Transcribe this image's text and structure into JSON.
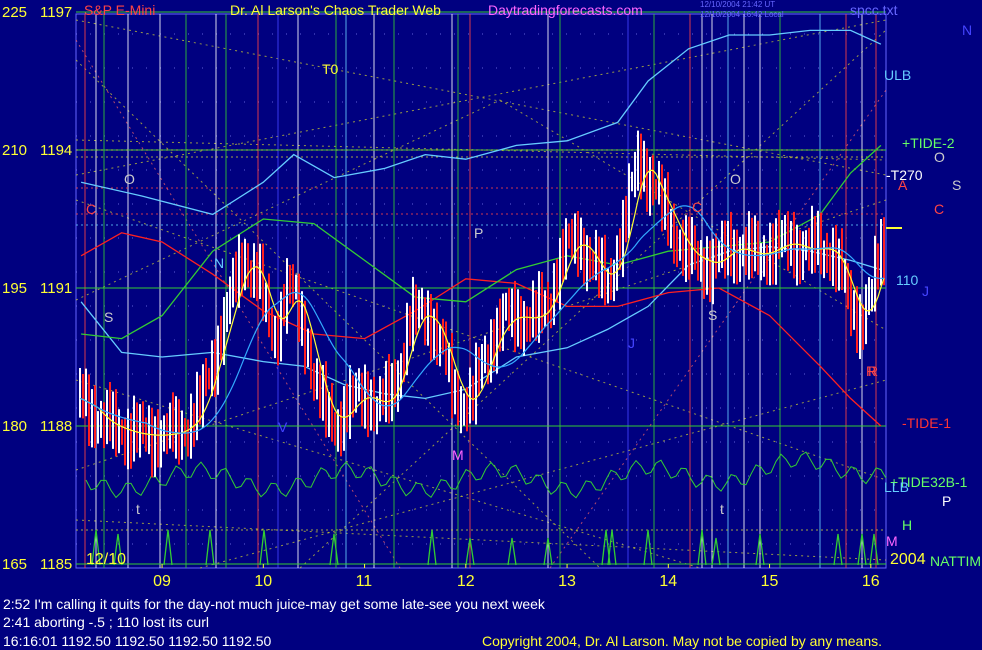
{
  "header": {
    "title_left": "S&P E-Mini",
    "title_center": "Dr. Al Larson's Chaos Trader Web",
    "site": "Daytradingforecasts.com",
    "ts1": "12/10/2004 21:42 UT",
    "ts2": "12/10/2004 16:42 Local",
    "file": "spcc.txt",
    "year": "2004",
    "date": "12/10"
  },
  "chart_data": {
    "type": "line",
    "title": "S&P E-Mini",
    "y_labels": [
      {
        "left": "225",
        "right": "1197",
        "value": 1197
      },
      {
        "left": "210",
        "right": "1194",
        "value": 1194
      },
      {
        "left": "195",
        "right": "1191",
        "value": 1191
      },
      {
        "left": "180",
        "right": "1188",
        "value": 1188
      },
      {
        "left": "165",
        "right": "1185",
        "value": 1185
      }
    ],
    "ylim": [
      1185,
      1197
    ],
    "x_ticks": [
      {
        "label": "09",
        "t": 9
      },
      {
        "label": "10",
        "t": 10
      },
      {
        "label": "11",
        "t": 11
      },
      {
        "label": "12",
        "t": 12
      },
      {
        "label": "13",
        "t": 13
      },
      {
        "label": "14",
        "t": 14
      },
      {
        "label": "15",
        "t": 15
      },
      {
        "label": "16",
        "t": 16
      }
    ],
    "xlim": [
      8.15,
      16.15
    ],
    "price": [
      [
        8.2,
        1188.6
      ],
      [
        8.4,
        1188.1
      ],
      [
        8.6,
        1187.9
      ],
      [
        8.8,
        1187.8
      ],
      [
        9.0,
        1187.8
      ],
      [
        9.2,
        1187.9
      ],
      [
        9.35,
        1188.3
      ],
      [
        9.5,
        1189.4
      ],
      [
        9.65,
        1190.6
      ],
      [
        9.8,
        1191.7
      ],
      [
        9.95,
        1191.2
      ],
      [
        10.1,
        1189.9
      ],
      [
        10.25,
        1191.1
      ],
      [
        10.4,
        1190.1
      ],
      [
        10.55,
        1188.6
      ],
      [
        10.7,
        1188.0
      ],
      [
        10.85,
        1188.5
      ],
      [
        11.0,
        1188.7
      ],
      [
        11.15,
        1188.4
      ],
      [
        11.3,
        1188.9
      ],
      [
        11.45,
        1190.3
      ],
      [
        11.6,
        1190.5
      ],
      [
        11.75,
        1189.8
      ],
      [
        11.9,
        1188.6
      ],
      [
        12.05,
        1188.5
      ],
      [
        12.2,
        1189.6
      ],
      [
        12.35,
        1190.3
      ],
      [
        12.5,
        1190.4
      ],
      [
        12.65,
        1190.3
      ],
      [
        12.8,
        1190.6
      ],
      [
        12.95,
        1191.7
      ],
      [
        13.1,
        1192.1
      ],
      [
        13.25,
        1191.5
      ],
      [
        13.4,
        1191.1
      ],
      [
        13.55,
        1192.2
      ],
      [
        13.7,
        1193.9
      ],
      [
        13.85,
        1193.2
      ],
      [
        14.0,
        1192.5
      ],
      [
        14.15,
        1191.8
      ],
      [
        14.3,
        1191.6
      ],
      [
        14.45,
        1191.5
      ],
      [
        14.6,
        1191.9
      ],
      [
        14.75,
        1191.8
      ],
      [
        14.9,
        1191.7
      ],
      [
        15.05,
        1191.9
      ],
      [
        15.2,
        1192.0
      ],
      [
        15.35,
        1191.8
      ],
      [
        15.5,
        1191.9
      ],
      [
        15.65,
        1191.7
      ],
      [
        15.8,
        1190.6
      ],
      [
        15.9,
        1190.3
      ],
      [
        16.0,
        1190.8
      ],
      [
        16.1,
        1191.8
      ]
    ],
    "bands": {
      "ulb": [
        [
          8.2,
          1193.3
        ],
        [
          8.8,
          1193.0
        ],
        [
          9.5,
          1192.6
        ],
        [
          10.0,
          1193.3
        ],
        [
          10.3,
          1193.9
        ],
        [
          10.7,
          1193.4
        ],
        [
          11.2,
          1193.6
        ],
        [
          11.6,
          1193.9
        ],
        [
          12.0,
          1193.8
        ],
        [
          12.5,
          1194.1
        ],
        [
          13.0,
          1194.2
        ],
        [
          13.5,
          1194.6
        ],
        [
          13.8,
          1195.5
        ],
        [
          14.2,
          1196.2
        ],
        [
          14.6,
          1196.5
        ],
        [
          15.0,
          1196.5
        ],
        [
          15.4,
          1196.6
        ],
        [
          15.8,
          1196.6
        ],
        [
          16.1,
          1196.3
        ]
      ],
      "llb": [
        [
          8.2,
          1190.7
        ],
        [
          8.6,
          1189.6
        ],
        [
          9.0,
          1189.5
        ],
        [
          9.5,
          1189.6
        ],
        [
          10.0,
          1189.4
        ],
        [
          10.4,
          1189.3
        ],
        [
          10.8,
          1188.9
        ],
        [
          11.2,
          1188.7
        ],
        [
          11.6,
          1188.6
        ],
        [
          12.0,
          1188.8
        ],
        [
          12.5,
          1189.5
        ],
        [
          13.0,
          1189.7
        ],
        [
          13.4,
          1190.1
        ],
        [
          13.8,
          1190.6
        ],
        [
          14.2,
          1191.5
        ],
        [
          14.6,
          1191.8
        ],
        [
          15.0,
          1191.9
        ],
        [
          15.4,
          1191.8
        ],
        [
          15.8,
          1191.6
        ],
        [
          16.1,
          1191.4
        ]
      ],
      "tide_minus": [
        [
          8.2,
          1191.7
        ],
        [
          8.6,
          1192.2
        ],
        [
          9.0,
          1192.0
        ],
        [
          9.5,
          1191.3
        ],
        [
          10.0,
          1190.5
        ],
        [
          10.5,
          1190.0
        ],
        [
          11.0,
          1189.9
        ],
        [
          11.5,
          1190.5
        ],
        [
          12.0,
          1191.2
        ],
        [
          12.5,
          1191.1
        ],
        [
          13.0,
          1190.6
        ],
        [
          13.5,
          1190.6
        ],
        [
          14.0,
          1190.9
        ],
        [
          14.5,
          1191.0
        ],
        [
          15.0,
          1190.4
        ],
        [
          15.5,
          1189.3
        ],
        [
          15.8,
          1188.6
        ],
        [
          16.1,
          1188.0
        ]
      ],
      "tide_plus": [
        [
          8.2,
          1190.0
        ],
        [
          8.6,
          1189.9
        ],
        [
          9.0,
          1190.4
        ],
        [
          9.5,
          1191.8
        ],
        [
          10.0,
          1192.5
        ],
        [
          10.5,
          1192.4
        ],
        [
          11.0,
          1191.6
        ],
        [
          11.5,
          1190.8
        ],
        [
          12.0,
          1190.7
        ],
        [
          12.5,
          1191.4
        ],
        [
          13.0,
          1191.7
        ],
        [
          13.5,
          1191.5
        ],
        [
          14.0,
          1191.8
        ],
        [
          14.5,
          1191.9
        ],
        [
          15.0,
          1192.0
        ],
        [
          15.5,
          1192.6
        ],
        [
          15.8,
          1193.5
        ],
        [
          16.1,
          1194.1
        ]
      ]
    },
    "labels_right": [
      {
        "text": "ULB",
        "color": "#66ccff"
      },
      {
        "text": "+TIDE-2",
        "color": "#66ff66"
      },
      {
        "text": "-T270",
        "color": "#ffffff"
      },
      {
        "text": "110",
        "color": "#66ccff"
      },
      {
        "text": "-TIDE-1",
        "color": "#ff3333"
      },
      {
        "text": "+TIDE32B-1",
        "color": "#66ff66"
      },
      {
        "text": "LLB",
        "color": "#66ccff"
      },
      {
        "text": "NATTIM",
        "color": "#66ff66"
      }
    ],
    "letters_right": [
      "N",
      "O",
      "S",
      "C",
      "A",
      "J",
      "R",
      "P",
      "H",
      "M"
    ],
    "chart_letters": [
      "T0",
      "C",
      "O",
      "S",
      "N",
      "V",
      "M",
      "P",
      "C",
      "O",
      "S",
      "J",
      "R",
      "t",
      "t"
    ]
  },
  "messages": [
    "2:52 I'm calling it quits for the day-not much juice-may get some late-see you next week",
    "2:41 aborting -.5 ; 110 lost its curl",
    "16:16:01  1192.50 1192.50 1192.50 1192.50"
  ],
  "copyright": "Copyright 2004, Dr. Al Larson. May not be copied by any means.",
  "colors": {
    "background": "#000080",
    "price_up": "#ffffff",
    "price_down": "#ff2020",
    "grid_h": "#33cc33",
    "band_blue": "#66ccff",
    "band_green": "#33cc33",
    "band_red": "#ff2020",
    "ma": "#ffff33",
    "axis_text": "#ffff33"
  }
}
